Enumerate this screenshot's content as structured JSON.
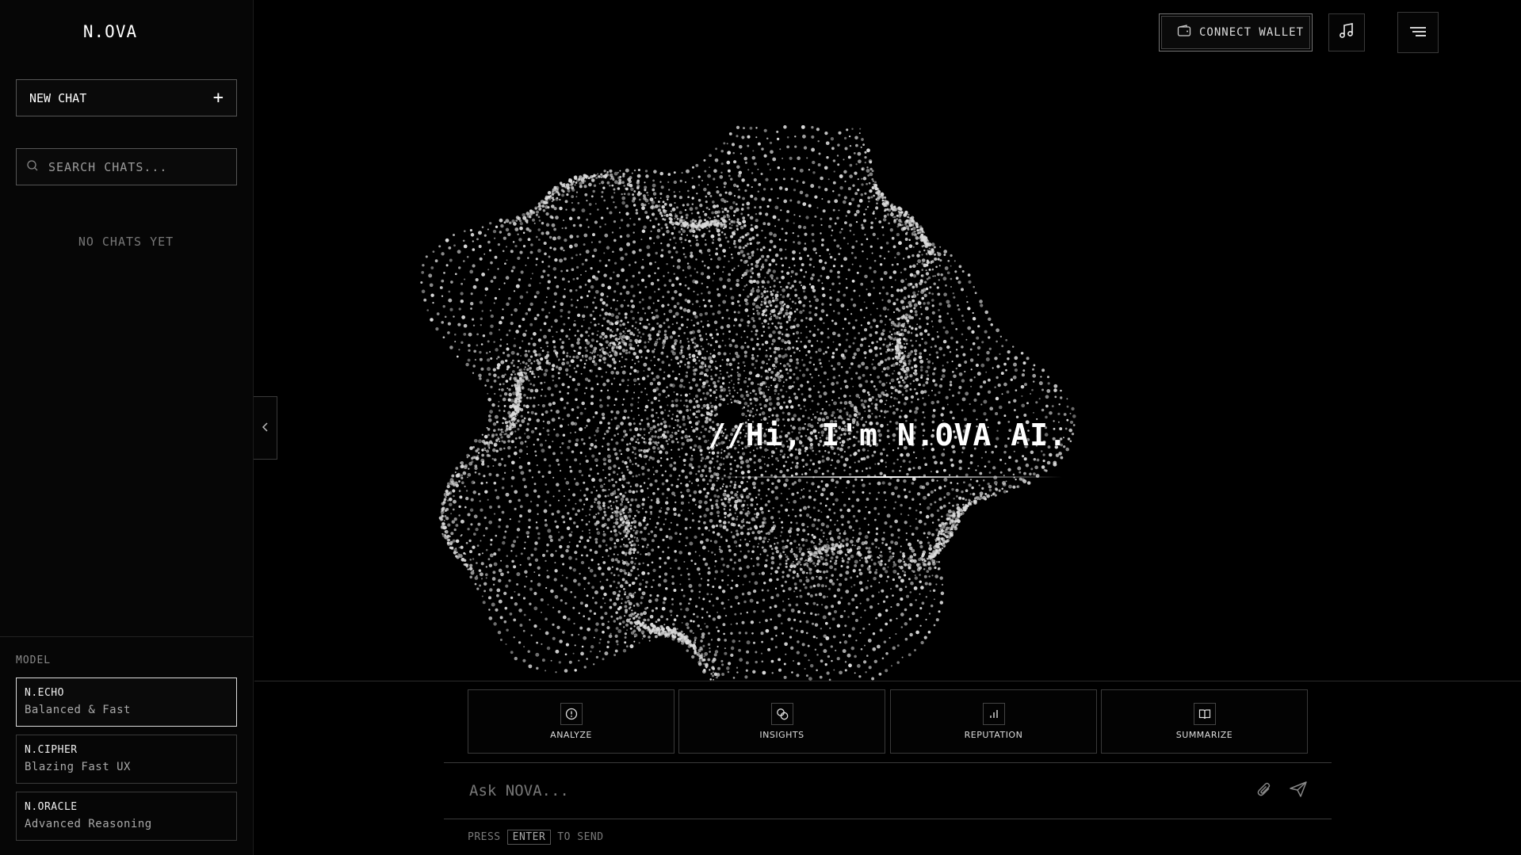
{
  "app": {
    "logo": "N.OVA"
  },
  "sidebar": {
    "new_chat_label": "NEW CHAT",
    "search_placeholder": "SEARCH CHATS...",
    "empty_state": "NO CHATS YET",
    "model_heading": "MODEL",
    "models": [
      {
        "name": "N.ECHO",
        "desc": "Balanced & Fast",
        "selected": true
      },
      {
        "name": "N.CIPHER",
        "desc": "Blazing Fast UX",
        "selected": false
      },
      {
        "name": "N.ORACLE",
        "desc": "Advanced Reasoning",
        "selected": false
      }
    ]
  },
  "topbar": {
    "wallet_label": "CONNECT WALLET",
    "music_icon": "music-note-icon",
    "menu_icon": "menu-icon"
  },
  "hero": {
    "title": "//Hi, I'm N.OVA AI."
  },
  "actions": [
    {
      "label": "ANALYZE",
      "icon": "alert-circle-icon"
    },
    {
      "label": "INSIGHTS",
      "icon": "coins-icon"
    },
    {
      "label": "REPUTATION",
      "icon": "bar-chart-icon"
    },
    {
      "label": "SUMMARIZE",
      "icon": "book-open-icon"
    }
  ],
  "composer": {
    "placeholder": "Ask NOVA...",
    "hint_press": "PRESS",
    "hint_key": "ENTER",
    "hint_tail": "TO SEND"
  },
  "colors": {
    "background": "#000000",
    "accent": "#ffffff",
    "border": "#3a3a3a"
  }
}
